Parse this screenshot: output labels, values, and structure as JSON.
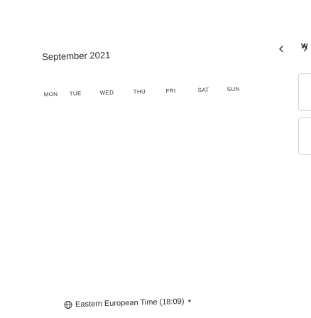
{
  "calendar": {
    "month_title": "September 2021",
    "prev_icon": "chevron-left-icon",
    "next_icon": "chevron-right-icon",
    "weekdays": [
      "MON",
      "TUE",
      "WED",
      "THU",
      "FRI",
      "SAT",
      "SUN"
    ]
  },
  "side": {
    "label": "W"
  },
  "footer": {
    "timezone_label": "Eastern European Time (18:09)",
    "timezone_icon": "globe-icon",
    "dropdown_icon": "caret-down-icon"
  },
  "colors": {
    "text": "#2b2b2b",
    "border": "#d6d6d6",
    "background": "#ffffff"
  }
}
